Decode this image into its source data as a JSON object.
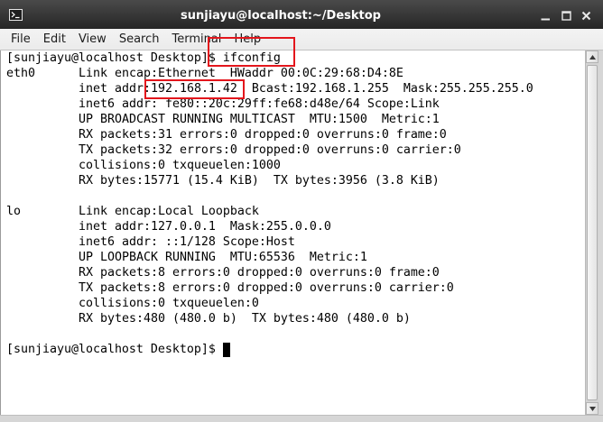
{
  "window": {
    "title": "sunjiayu@localhost:~/Desktop",
    "app_icon": "terminal-icon",
    "controls": [
      "minimize-icon",
      "maximize-icon",
      "close-icon"
    ]
  },
  "menu": {
    "items": [
      "File",
      "Edit",
      "View",
      "Search",
      "Terminal",
      "Help"
    ]
  },
  "terminal": {
    "command_line": {
      "prompt": "[sunjiayu@localhost Desktop]$",
      "command": "ifconfig"
    },
    "interfaces": [
      {
        "name": "eth0",
        "lines": [
          "Link encap:Ethernet  HWaddr 00:0C:29:68:D4:8E",
          {
            "label": "inet addr:",
            "address": "192.168.1.42",
            "rest": "Bcast:192.168.1.255  Mask:255.255.255.0"
          },
          "inet6 addr: fe80::20c:29ff:fe68:d48e/64 Scope:Link",
          "UP BROADCAST RUNNING MULTICAST  MTU:1500  Metric:1",
          "RX packets:31 errors:0 dropped:0 overruns:0 frame:0",
          "TX packets:32 errors:0 dropped:0 overruns:0 carrier:0",
          "collisions:0 txqueuelen:1000",
          "RX bytes:15771 (15.4 KiB)  TX bytes:3956 (3.8 KiB)"
        ]
      },
      {
        "name": "lo",
        "lines": [
          "Link encap:Local Loopback",
          "inet addr:127.0.0.1  Mask:255.0.0.0",
          "inet6 addr: ::1/128 Scope:Host",
          "UP LOOPBACK RUNNING  MTU:65536  Metric:1",
          "RX packets:8 errors:0 dropped:0 overruns:0 frame:0",
          "TX packets:8 errors:0 dropped:0 overruns:0 carrier:0",
          "collisions:0 txqueuelen:0",
          "RX bytes:480 (480.0 b)  TX bytes:480 (480.0 b)"
        ]
      }
    ],
    "final_prompt": "[sunjiayu@localhost Desktop]$"
  },
  "scrollbar": {
    "icons": [
      "scroll-up-arrow-icon",
      "scroll-down-arrow-icon"
    ]
  },
  "colors": {
    "title_bar_top": "#4a4a4a",
    "title_bar_bottom": "#262626",
    "title_text": "#ffffff",
    "menu_bg": "#ebebeb",
    "menu_text": "#1c1c1c",
    "terminal_bg": "#ffffff",
    "terminal_fg": "#000000",
    "cursor": "#000000",
    "annotation": "#e3161c"
  }
}
